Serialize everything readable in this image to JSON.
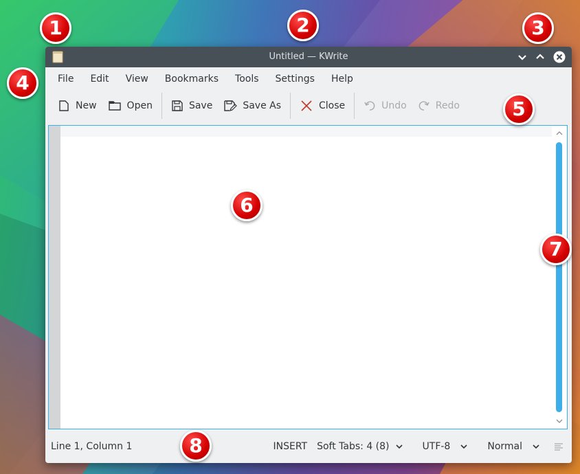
{
  "window": {
    "title": "Untitled — KWrite"
  },
  "menu": [
    {
      "label": "File"
    },
    {
      "label": "Edit"
    },
    {
      "label": "View"
    },
    {
      "label": "Bookmarks"
    },
    {
      "label": "Tools"
    },
    {
      "label": "Settings"
    },
    {
      "label": "Help"
    }
  ],
  "toolbar": {
    "new_label": "New",
    "open_label": "Open",
    "save_label": "Save",
    "save_as_label": "Save As",
    "close_label": "Close",
    "undo_label": "Undo",
    "redo_label": "Redo"
  },
  "status": {
    "position": "Line 1, Column 1",
    "mode": "INSERT",
    "indentation": "Soft Tabs: 4 (8)",
    "encoding": "UTF-8",
    "highlight": "Normal"
  },
  "badges": [
    "1",
    "2",
    "3",
    "4",
    "5",
    "6",
    "7",
    "8"
  ],
  "colors": {
    "accent": "#3daee9",
    "titlebar": "#475057",
    "window_bg": "#eff0f1",
    "badge": "#d40000",
    "close_icon": "#c0392b"
  },
  "icons": {
    "app": "kwrite-app-icon",
    "new": "new-document-icon",
    "open": "folder-open-icon",
    "save": "save-icon",
    "save_as": "save-as-icon",
    "close": "close-x-icon",
    "undo": "undo-icon",
    "redo": "redo-icon"
  }
}
